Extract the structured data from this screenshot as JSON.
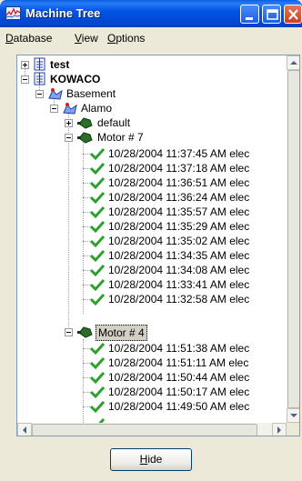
{
  "window": {
    "title": "Machine Tree"
  },
  "menu": [
    {
      "label": "Database",
      "accel": "D",
      "rest": "atabase"
    },
    {
      "label": "View",
      "accel": "V",
      "rest": "iew"
    },
    {
      "label": "Options",
      "accel": "O",
      "rest": "ptions"
    }
  ],
  "tree": {
    "root_nodes": [
      "test",
      "KOWACO"
    ],
    "basement": "Basement",
    "alamo": "Alamo",
    "default": "default",
    "motor7": "Motor # 7",
    "motor4": "Motor # 4",
    "motor7_entries": [
      "10/28/2004 11:37:45 AM elec",
      "10/28/2004 11:37:18 AM elec",
      "10/28/2004 11:36:51 AM elec",
      "10/28/2004 11:36:24 AM elec",
      "10/28/2004 11:35:57 AM elec",
      "10/28/2004 11:35:29 AM elec",
      "10/28/2004 11:35:02 AM elec",
      "10/28/2004 11:34:35 AM elec",
      "10/28/2004 11:34:08 AM elec",
      "10/28/2004 11:33:41 AM elec",
      "10/28/2004 11:32:58 AM elec"
    ],
    "motor4_entries": [
      "10/28/2004 11:51:38 AM elec",
      "10/28/2004 11:51:11 AM elec",
      "10/28/2004 11:50:44 AM elec",
      "10/28/2004 11:50:17 AM elec",
      "10/28/2004 11:49:50 AM elec"
    ]
  },
  "buttons": {
    "hide_accel": "H",
    "hide_rest": "ide"
  },
  "colors": {
    "title_bar": "#0055e5",
    "check": "#2ea02e",
    "node_blue": "#1f3fa8"
  }
}
